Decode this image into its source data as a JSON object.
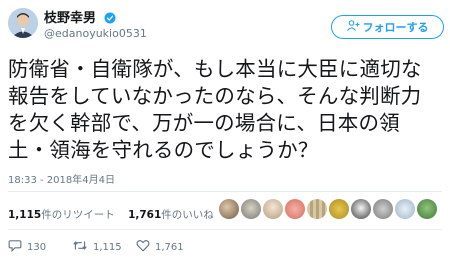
{
  "author": {
    "display_name": "枝野幸男",
    "screen_name": "@edanoyukio0531",
    "avatar_icon": "profile-photo",
    "verified_icon": "verified-badge-icon"
  },
  "follow_button": {
    "label": "フォローする",
    "icon": "add-user-icon",
    "color": "#1da1f2"
  },
  "tweet": {
    "text": "防衛省・自衛隊が、もし本当に大臣に適切な報告をしていなかったのなら、そんな判断力を欠く幹部で、万が一の場合に、日本の領土・領海を守れるのでしょうか？",
    "timestamp": "18:33 - 2018年4月4日"
  },
  "stats": {
    "retweet_count": "1,115",
    "retweet_label": "件のリツイート",
    "like_count": "1,761",
    "like_label": "件のいいね"
  },
  "likers": {
    "count_shown": 10
  },
  "actions": {
    "reply_count": "130",
    "retweet_count": "1,115",
    "like_count": "1,761",
    "reply_icon": "reply-icon",
    "retweet_icon": "retweet-icon",
    "like_icon": "heart-icon"
  },
  "colors": {
    "accent": "#1da1f2",
    "text": "#14171a",
    "muted": "#657786",
    "divider": "#e6ecf0"
  }
}
